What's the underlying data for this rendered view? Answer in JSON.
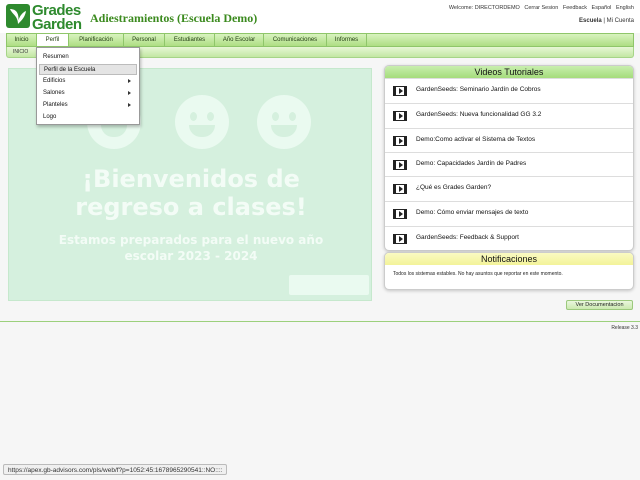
{
  "header": {
    "logo": {
      "line1": "Grades",
      "line2": "Garden"
    },
    "app_title": "Adiestramientos (Escuela Demo)",
    "top_links": [
      "Welcome: DIRECTORDEMO",
      "Cerrar Sesion",
      "Feedback",
      "Español",
      "English"
    ],
    "school_current": "Escuela",
    "school_separator": " | ",
    "school_other": "Mi Cuenta"
  },
  "nav": {
    "items": [
      "Inicio",
      "Perfil",
      "Planificación",
      "Personal",
      "Estudiantes",
      "Año Escolar",
      "Comunicaciones",
      "Informes"
    ],
    "active_index": 1,
    "sub_label": "INICIO"
  },
  "dropdown": {
    "items": [
      {
        "label": "Resumen",
        "has_submenu": false
      },
      {
        "label": "Perfil de la Escuela",
        "has_submenu": false,
        "highlighted": true
      },
      {
        "label": "Edificios",
        "has_submenu": true
      },
      {
        "label": "Salones",
        "has_submenu": true
      },
      {
        "label": "Planteles",
        "has_submenu": true
      },
      {
        "label": "Logo",
        "has_submenu": false
      }
    ]
  },
  "banner": {
    "headline_line1": "¡Bienvenidos de",
    "headline_line2": "regreso a clases!",
    "subline_1": "Estamos preparados para el nuevo año",
    "subline_2": "escolar 2023 - 2024"
  },
  "videos": {
    "title": "Videos Tutoriales",
    "items": [
      "GardenSeeds: Seminario Jardín de Cobros",
      "GardenSeeds: Nueva funcionalidad GG 3.2",
      "Demo:Como activar el Sistema de Textos",
      "Demo: Capacidades Jardín de Padres",
      "¿Qué es Grades Garden?",
      "Demo: Cómo enviar mensajes de texto",
      "GardenSeeds: Feedback & Support"
    ]
  },
  "notifications": {
    "title": "Notificaciones",
    "text": "Todos los sistemas estables. No hay asuntos que reportar en este momento."
  },
  "doc_button": "Ver Documentacion",
  "release": "Release 3.3",
  "status_url": "https://apex.gb-advisors.com/pls/web/f?p=1052:45:1678965290541::NO::::",
  "colors": {
    "brand_green": "#2e8a2e",
    "nav_green": "#aede84",
    "panel_yellow": "#f3f399",
    "banner_green": "#d5f0de"
  }
}
